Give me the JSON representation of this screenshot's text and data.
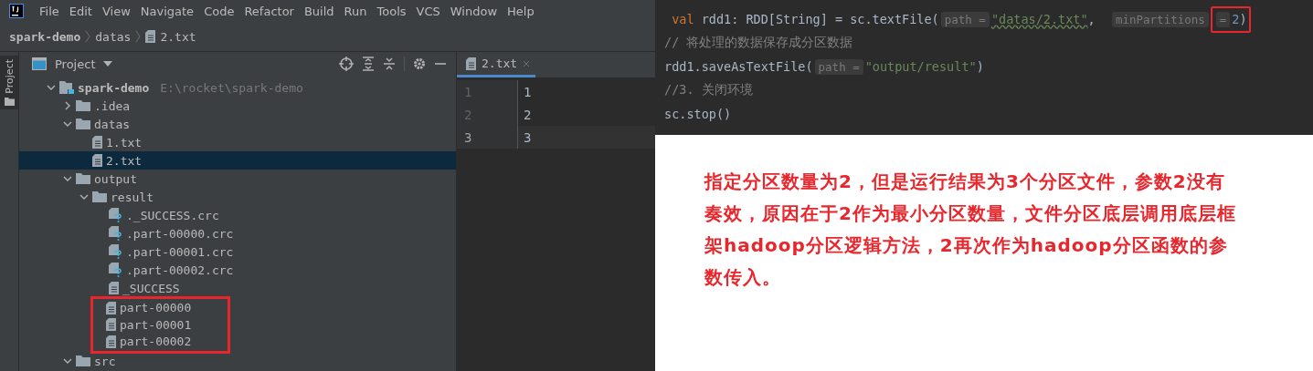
{
  "menu": [
    "File",
    "Edit",
    "View",
    "Navigate",
    "Code",
    "Refactor",
    "Build",
    "Run",
    "Tools",
    "VCS",
    "Window",
    "Help"
  ],
  "breadcrumb": [
    {
      "label": "spark-demo",
      "kind": "project"
    },
    {
      "label": "datas",
      "kind": "folder"
    },
    {
      "label": "2.txt",
      "kind": "file"
    }
  ],
  "side_tab": "Project",
  "project_panel": {
    "title": "Project",
    "tree": [
      {
        "name": "spark-demo",
        "kind": "module",
        "hint": "E:\\rocket\\spark-demo",
        "expanded": true,
        "selected": false,
        "highlighted": false,
        "children": [
          {
            "name": ".idea",
            "kind": "folder",
            "expanded": false,
            "selected": false,
            "highlighted": false
          },
          {
            "name": "datas",
            "kind": "folder",
            "expanded": true,
            "selected": false,
            "highlighted": false,
            "children": [
              {
                "name": "1.txt",
                "kind": "file",
                "selected": false,
                "highlighted": false
              },
              {
                "name": "2.txt",
                "kind": "file",
                "selected": true,
                "highlighted": false
              }
            ]
          },
          {
            "name": "output",
            "kind": "folder",
            "expanded": true,
            "selected": false,
            "highlighted": false,
            "children": [
              {
                "name": "result",
                "kind": "folder",
                "expanded": true,
                "selected": false,
                "highlighted": false,
                "children": [
                  {
                    "name": "._SUCCESS.crc",
                    "kind": "crc",
                    "selected": false,
                    "highlighted": false
                  },
                  {
                    "name": ".part-00000.crc",
                    "kind": "crc",
                    "selected": false,
                    "highlighted": false
                  },
                  {
                    "name": ".part-00001.crc",
                    "kind": "crc",
                    "selected": false,
                    "highlighted": false
                  },
                  {
                    "name": ".part-00002.crc",
                    "kind": "crc",
                    "selected": false,
                    "highlighted": false
                  },
                  {
                    "name": "_SUCCESS",
                    "kind": "file",
                    "selected": false,
                    "highlighted": false
                  },
                  {
                    "name": "part-00000",
                    "kind": "file",
                    "selected": false,
                    "highlighted": true
                  },
                  {
                    "name": "part-00001",
                    "kind": "file",
                    "selected": false,
                    "highlighted": true
                  },
                  {
                    "name": "part-00002",
                    "kind": "file",
                    "selected": false,
                    "highlighted": true
                  }
                ]
              }
            ]
          },
          {
            "name": "src",
            "kind": "folder",
            "expanded": true,
            "selected": false,
            "highlighted": false
          }
        ]
      }
    ]
  },
  "editor": {
    "tab": "2.txt",
    "lines": [
      {
        "number": "1",
        "text": "1",
        "current": false
      },
      {
        "number": "2",
        "text": "2",
        "current": false
      },
      {
        "number": "3",
        "text": "3",
        "current": true
      }
    ]
  },
  "code": [
    [
      {
        "kind": "keyword",
        "text": " val "
      },
      {
        "kind": "plain",
        "text": "rdd1: RDD[String] = sc.textFile("
      },
      {
        "kind": "hint",
        "text": "path ="
      },
      {
        "kind": "string",
        "text": "\"datas/2.txt\""
      },
      {
        "kind": "plain",
        "text": ",  "
      },
      {
        "kind": "hint",
        "text": "minPartitions"
      },
      {
        "kind": "box",
        "children": [
          {
            "kind": "hint",
            "text": "="
          },
          {
            "kind": "number",
            "text": "2"
          },
          {
            "kind": "plain",
            "text": ")"
          }
        ]
      }
    ],
    [
      {
        "kind": "comment",
        "text": "// 将处理的数据保存成分区数据"
      }
    ],
    [
      {
        "kind": "plain",
        "text": "rdd1.saveAsTextFile("
      },
      {
        "kind": "hint",
        "text": "path ="
      },
      {
        "kind": "string",
        "text": "\"output/result\""
      },
      {
        "kind": "plain",
        "text": ")"
      }
    ],
    [
      {
        "kind": "comment",
        "text": "//3. 关闭环境"
      }
    ],
    [
      {
        "kind": "plain",
        "text": "sc.stop()"
      }
    ]
  ],
  "note": "指定分区数量为2，但是运行结果为3个分区文件，参数2没有奏效，原因在于2作为最小分区数量，文件分区底层调用底层框架hadoop分区逻辑方法，2再次作为hadoop分区函数的参数传入。"
}
